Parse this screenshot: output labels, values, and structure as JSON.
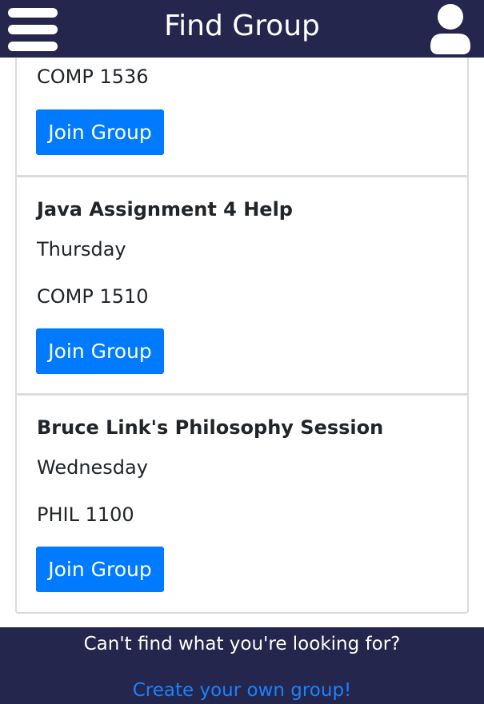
{
  "header": {
    "title": "Find Group",
    "menu_icon": "hamburger-menu-icon",
    "profile_icon": "user-profile-icon"
  },
  "groups": [
    {
      "name": "",
      "day": "",
      "course": "COMP 1536",
      "button_label": "Join Group"
    },
    {
      "name": "Java Assignment 4 Help",
      "day": "Thursday",
      "course": "COMP 1510",
      "button_label": "Join Group"
    },
    {
      "name": "Bruce Link's Philosophy Session",
      "day": "Wednesday",
      "course": "PHIL 1100",
      "button_label": "Join Group"
    }
  ],
  "footer": {
    "message": "Can't find what you're looking for?",
    "link": "Create your own group!"
  },
  "colors": {
    "nav_background": "#24264d",
    "button": "#007bff",
    "link": "#1a82ff"
  }
}
